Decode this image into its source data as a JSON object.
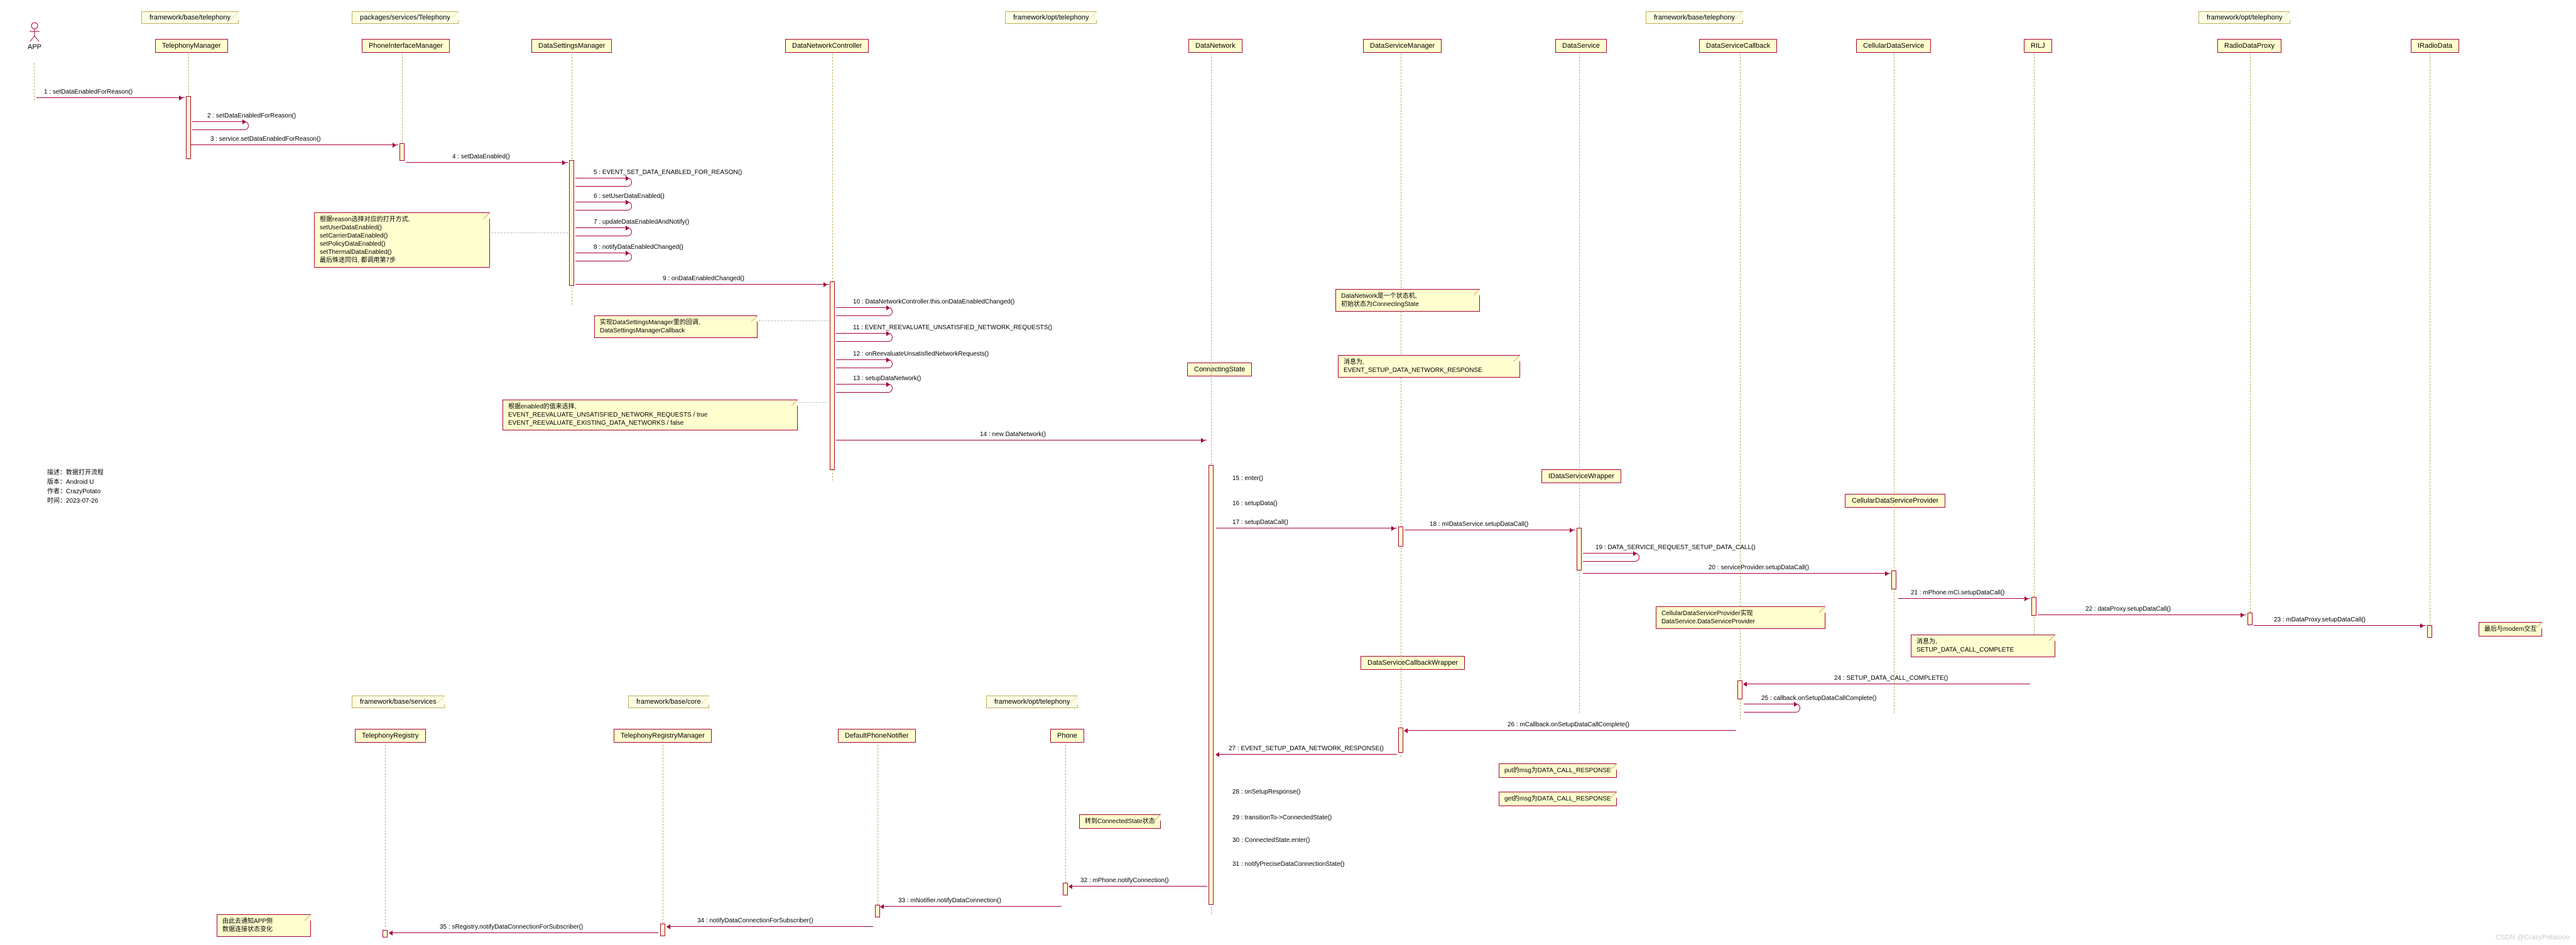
{
  "packages": {
    "p1": "framework/base/telephony",
    "p2": "packages/services/Telephony",
    "p3": "framework/opt/telephony",
    "p4": "framework/base/telephony",
    "p5": "framework/opt/telephony",
    "p6": "framework/base/services",
    "p7": "framework/base/core",
    "p8": "framework/opt/telephony"
  },
  "actors": {
    "app": "APP"
  },
  "participants": {
    "tm": "TelephonyManager",
    "pim": "PhoneInterfaceManager",
    "dsm": "DataSettingsManager",
    "dnc": "DataNetworkController",
    "dn": "DataNetwork",
    "dsvm": "DataServiceManager",
    "ds": "DataService",
    "dscb": "DataServiceCallback",
    "cds": "CellularDataService",
    "rilj": "RILJ",
    "rdp": "RadioDataProxy",
    "ird": "IRadioData",
    "cs": "ConnectingState",
    "idsw": "IDataServiceWrapper",
    "cdsp": "CellularDataServiceProvider",
    "dscbw": "DataServiceCallbackWrapper",
    "tr": "TelephonyRegistry",
    "trm": "TelephonyRegistryManager",
    "dpn": "DefaultPhoneNotifier",
    "phone": "Phone"
  },
  "messages": {
    "m1": "1 : setDataEnabledForReason()",
    "m2": "2 : setDataEnabledForReason()",
    "m3": "3 : service.setDataEnabledForReason()",
    "m4": "4 : setDataEnabled()",
    "m5": "5 : EVENT_SET_DATA_ENABLED_FOR_REASON()",
    "m6": "6 : setUserDataEnabled()",
    "m7": "7 : updateDataEnabledAndNotify()",
    "m8": "8 : notifyDataEnabledChanged()",
    "m9": "9 : onDataEnabledChanged()",
    "m10": "10 : DataNetworkController.this.onDataEnabledChanged()",
    "m11": "11 : EVENT_REEVALUATE_UNSATISFIED_NETWORK_REQUESTS()",
    "m12": "12 : onReevaluateUnsatisfiedNetworkRequests()",
    "m13": "13 : setupDataNetwork()",
    "m14": "14 : new DataNetwork()",
    "m15": "15 : enter()",
    "m16": "16 : setupData()",
    "m17": "17 : setupDataCall()",
    "m18": "18 : mIDataService.setupDataCall()",
    "m19": "19 : DATA_SERVICE_REQUEST_SETUP_DATA_CALL()",
    "m20": "20 : serviceProvider.setupDataCall()",
    "m21": "21 : mPhone.mCi.setupDataCall()",
    "m22": "22 : dataProxy.setupDataCall()",
    "m23": "23 : mDataProxy.setupDataCall()",
    "m24": "24 : SETUP_DATA_CALL_COMPLETE()",
    "m25": "25 : callback.onSetupDataCallComplete()",
    "m26": "26 : mCallback.onSetupDataCallComplete()",
    "m27": "27 : EVENT_SETUP_DATA_NETWORK_RESPONSE()",
    "m28": "28 : onSetupResponse()",
    "m29": "29 : transitionTo->ConnectedState()",
    "m30": "30 : ConnectedState.enter()",
    "m31": "31 : notifyPreciseDataConnectionState()",
    "m32": "32 : mPhone.notifyConnection()",
    "m33": "33 : mNotifier.notifyDataConnection()",
    "m34": "34 : notifyDataConnectionForSubscriber()",
    "m35": "35 : sRegistry.notifyDataConnectionForSubscriber()"
  },
  "notes": {
    "n1_l1": "根据reason选择对应的打开方式,",
    "n1_l2": "setUserDataEnabled()",
    "n1_l3": "setCarrierDataEnabled()",
    "n1_l4": "setPolicyDataEnabled()",
    "n1_l5": "setThermalDataEnabled()",
    "n1_l6": "最后殊途同归, 都调用第7步",
    "n2_l1": "实现DataSettingsManager里的回调,",
    "n2_l2": "DataSettingsManagerCallback",
    "n3_l1": "根据enabled的值来选择,",
    "n3_l2": "EVENT_REEVALUATE_UNSATISFIED_NETWORK_REQUESTS / true",
    "n3_l3": "EVENT_REEVALUATE_EXISTING_DATA_NETWORKS / false",
    "n4_l1": "DataNetwork是一个状态机,",
    "n4_l2": "初始状态为ConnectingState",
    "n5_l1": "消息为,",
    "n5_l2": "EVENT_SETUP_DATA_NETWORK_RESPONSE",
    "n6_l1": "CellularDataServiceProvider实现",
    "n6_l2": "DataService.DataServiceProvider",
    "n7_l1": "消息为,",
    "n7_l2": "SETUP_DATA_CALL_COMPLETE",
    "n8": "put的msg为DATA_CALL_RESPONSE",
    "n9": "get的msg为DATA_CALL_RESPONSE",
    "n10": "转到ConnectedState状态",
    "n11_l1": "由此去通知APP侧",
    "n11_l2": "数据连接状态变化",
    "n12": "最后与modem交互"
  },
  "meta": {
    "l1": "描述：数据打开流程",
    "l2": "版本：Android U",
    "l3": "作者：CrazyPotato",
    "l4": "时间：2023-07-26"
  },
  "watermark": "CSDN @CrazyPotatooo"
}
